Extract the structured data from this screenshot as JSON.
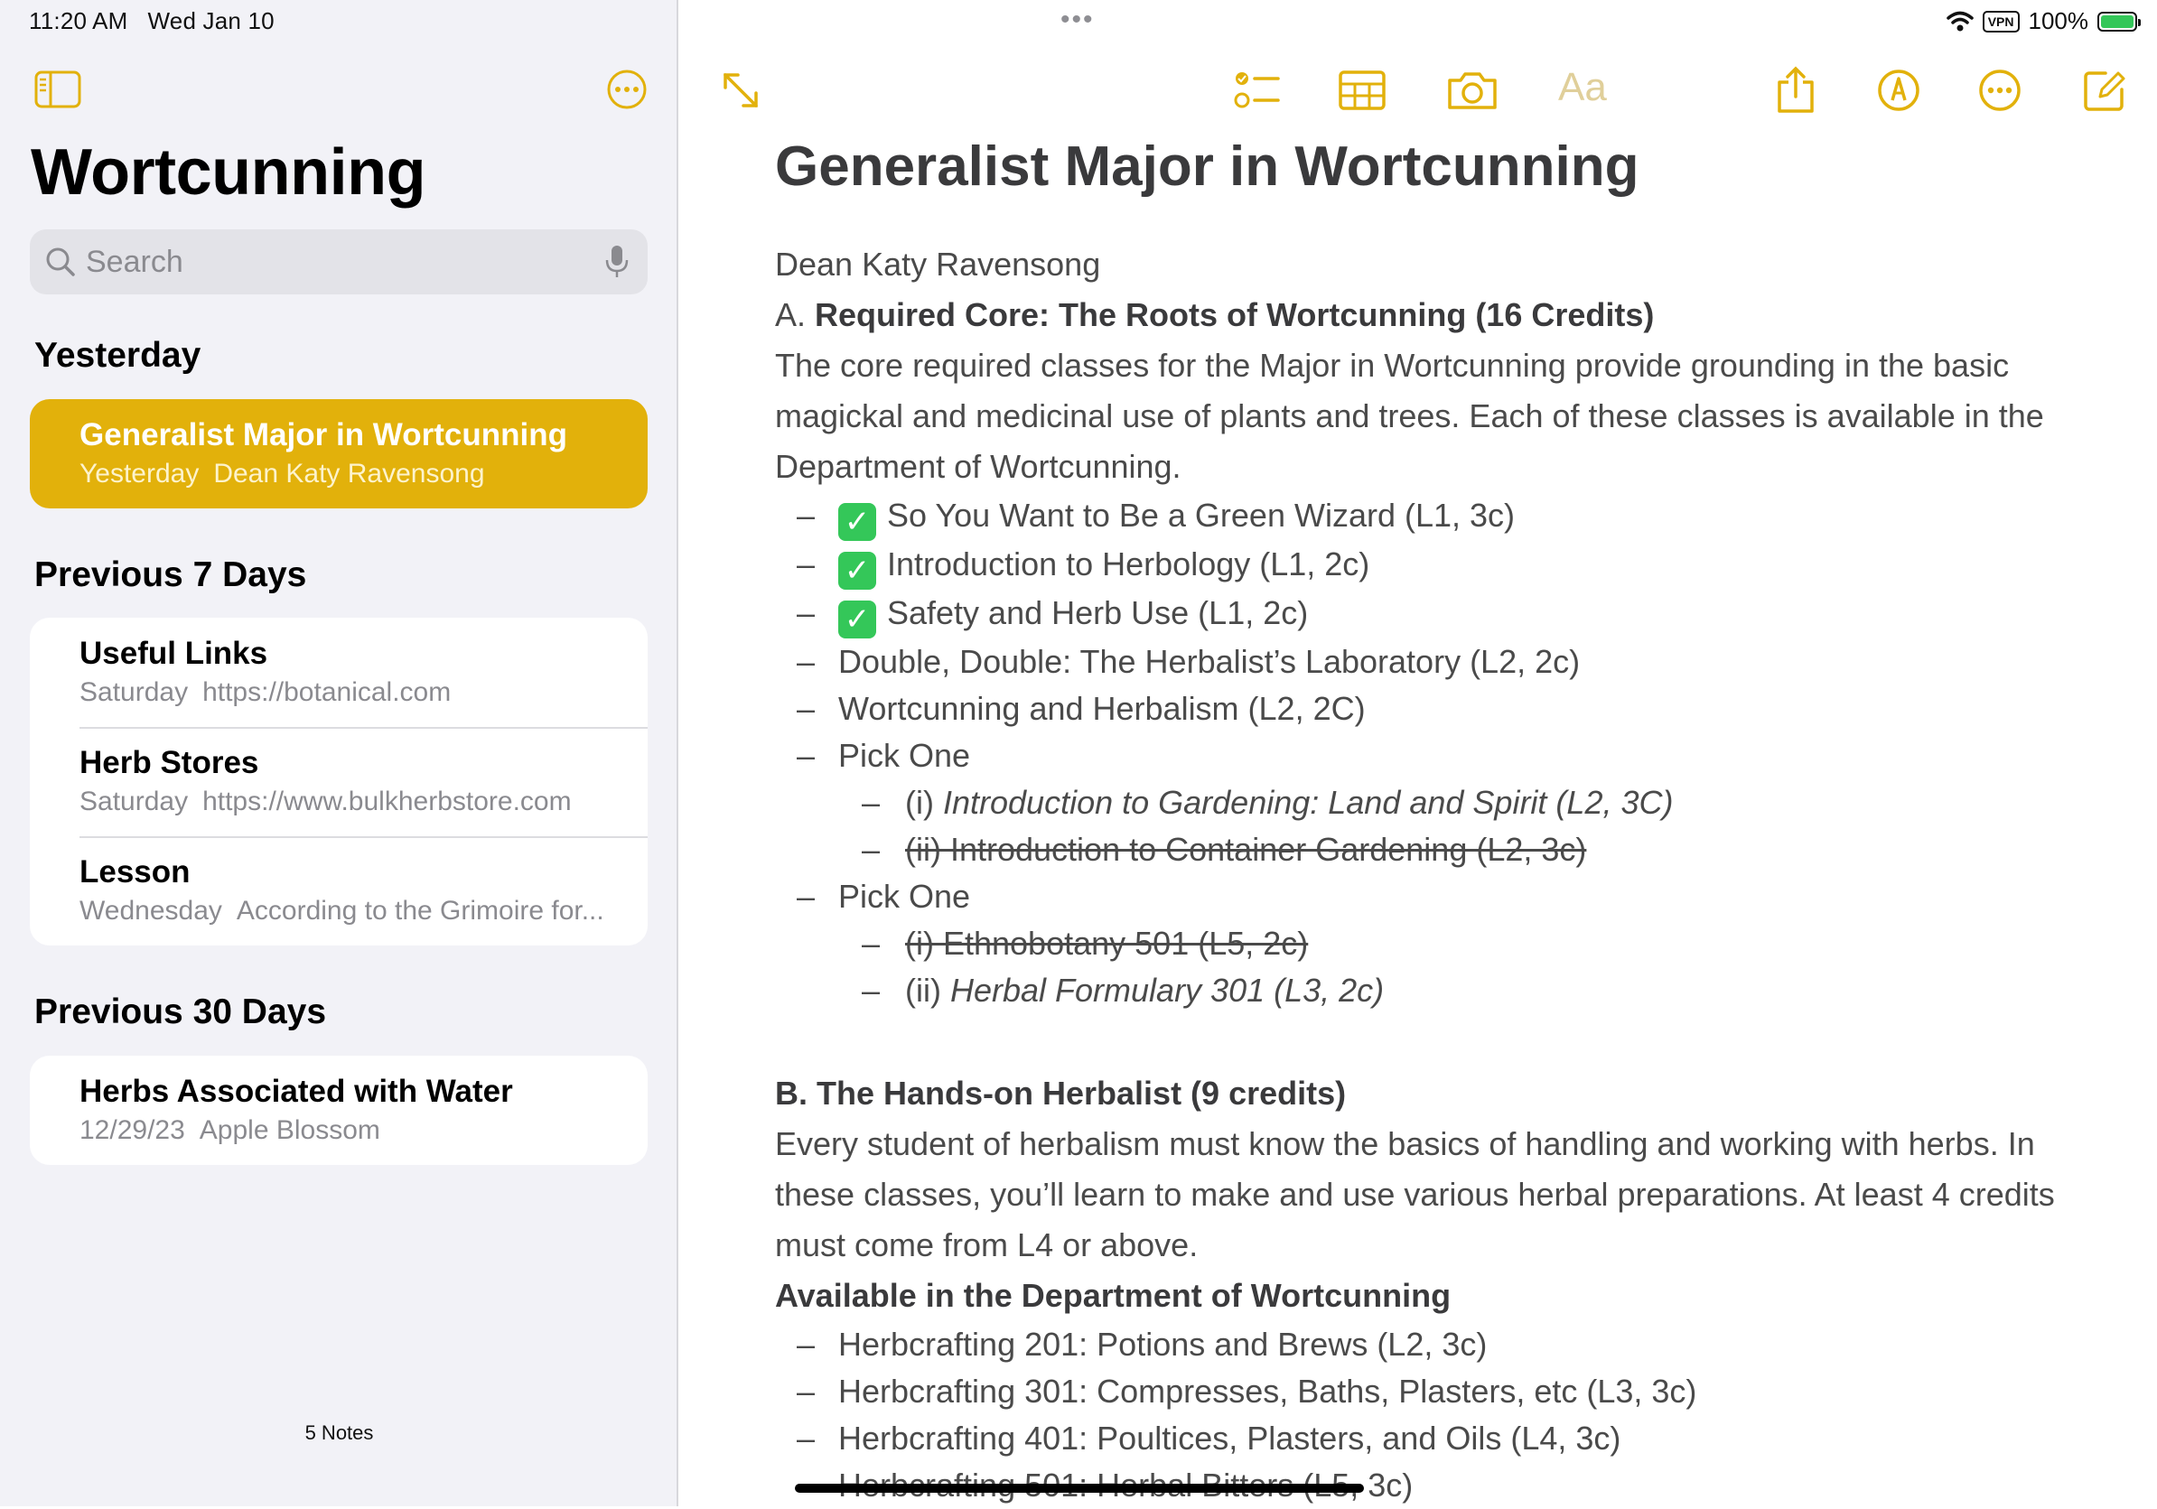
{
  "status": {
    "time": "11:20 AM",
    "date": "Wed Jan 10",
    "vpn": "VPN",
    "battery": "100%"
  },
  "sidebar": {
    "title": "Wortcunning",
    "search_placeholder": "Search",
    "sections": {
      "yesterday": {
        "header": "Yesterday",
        "notes": [
          {
            "title": "Generalist Major in Wortcunning",
            "date": "Yesterday",
            "preview": "Dean Katy Ravensong"
          }
        ]
      },
      "prev7": {
        "header": "Previous 7 Days",
        "notes": [
          {
            "title": "Useful Links",
            "date": "Saturday",
            "preview": "https://botanical.com"
          },
          {
            "title": "Herb Stores",
            "date": "Saturday",
            "preview": "https://www.bulkherbstore.com"
          },
          {
            "title": "Lesson",
            "date": "Wednesday",
            "preview": "According to the Grimoire for..."
          }
        ]
      },
      "prev30": {
        "header": "Previous 30 Days",
        "notes": [
          {
            "title": "Herbs Associated with Water",
            "date": "12/29/23",
            "preview": "Apple Blossom"
          }
        ]
      }
    },
    "notes_count": "5 Notes"
  },
  "toolbar": {
    "format_label": "Aa"
  },
  "note": {
    "title": "Generalist Major in Wortcunning",
    "author": "Dean Katy Ravensong",
    "sectionA_prefix": "A. ",
    "sectionA_heading": "Required Core: The Roots of Wortcunning (16 Credits)",
    "sectionA_body": "The core required classes for the Major in Wortcunning provide grounding in the basic magickal and medicinal use of plants and trees. Each of these classes is available in the Department of Wortcunning.",
    "checked_items": [
      "So You Want to Be a Green Wizard (L1, 3c)",
      "Introduction to Herbology (L1, 2c)",
      "Safety and Herb Use (L1, 2c)"
    ],
    "plain_items": [
      "Double, Double: The Herbalist’s Laboratory (L2, 2c)",
      "Wortcunning and Herbalism (L2, 2C)"
    ],
    "pick_one_label": "Pick One",
    "pick1": {
      "opt1_prefix": "(i) ",
      "opt1_text": "Introduction to Gardening: Land and Spirit (L2, 3C)",
      "opt2": "(ii) Introduction to Container Gardening (L2, 3c)"
    },
    "pick2": {
      "opt1": "(i) Ethnobotany 501 (L5, 2c)",
      "opt2_prefix": "(ii) ",
      "opt2_text": "Herbal Formulary 301 (L3, 2c)"
    },
    "sectionB_heading": "B. The Hands-on Herbalist (9 credits)",
    "sectionB_body": "Every student of herbalism must know the basics of handling and working with herbs. In these classes, you’ll learn to make and use various herbal preparations. At least 4 credits must come from L4 or above.",
    "available_heading": "Available in the Department of Wortcunning",
    "herbcrafting": [
      "Herbcrafting 201: Potions and Brews (L2, 3c)",
      "Herbcrafting 301: Compresses, Baths, Plasters, etc (L3, 3c)",
      "Herbcrafting 401: Poultices, Plasters, and Oils (L4, 3c)",
      "Herbcrafting 501: Herbal Bitters (L5, 3c)"
    ]
  },
  "colors": {
    "accent": "#e2b10b",
    "sidebar_bg": "#f2f2f7",
    "check_green": "#34c759"
  }
}
